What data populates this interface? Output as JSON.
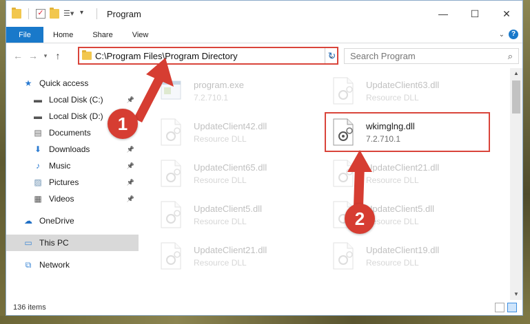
{
  "window": {
    "title": "Program",
    "controls": {
      "minimize": "—",
      "maximize": "☐",
      "close": "✕"
    }
  },
  "ribbon": {
    "tabs": [
      "File",
      "Home",
      "Share",
      "View"
    ],
    "help": "?"
  },
  "address": {
    "path": "C:\\Program Files\\Program Directory",
    "search_placeholder": "Search Program"
  },
  "nav": {
    "quick_access": "Quick access",
    "items": [
      {
        "label": "Local Disk (C:)",
        "icon": "drive-icon",
        "pinned": true
      },
      {
        "label": "Local Disk (D:)",
        "icon": "drive-icon",
        "pinned": false
      },
      {
        "label": "Documents",
        "icon": "documents-icon",
        "pinned": true
      },
      {
        "label": "Downloads",
        "icon": "download-icon",
        "pinned": true
      },
      {
        "label": "Music",
        "icon": "music-icon",
        "pinned": true
      },
      {
        "label": "Pictures",
        "icon": "pictures-icon",
        "pinned": true
      },
      {
        "label": "Videos",
        "icon": "videos-icon",
        "pinned": true
      }
    ],
    "onedrive": "OneDrive",
    "this_pc": "This PC",
    "network": "Network"
  },
  "files": [
    {
      "name": "program.exe",
      "desc": "7.2.710.1",
      "icon": "exe-icon",
      "faded": true
    },
    {
      "name": "UpdateClient63.dll",
      "desc": "Resource DLL",
      "icon": "dll-icon",
      "faded": true
    },
    {
      "name": "UpdateClient42.dll",
      "desc": "Resource DLL",
      "icon": "dll-icon",
      "faded": true
    },
    {
      "name": "wkimglng.dll",
      "desc": "7.2.710.1",
      "icon": "dll-gear-icon",
      "faded": false
    },
    {
      "name": "UpdateClient65.dll",
      "desc": "Resource DLL",
      "icon": "dll-icon",
      "faded": true
    },
    {
      "name": "UpdateClient21.dll",
      "desc": "Resource DLL",
      "icon": "dll-icon",
      "faded": true
    },
    {
      "name": "UpdateClient5.dll",
      "desc": "Resource DLL",
      "icon": "dll-icon",
      "faded": true
    },
    {
      "name": "UpdateClient5.dll",
      "desc": "Resource DLL",
      "icon": "dll-icon",
      "faded": true
    },
    {
      "name": "UpdateClient21.dll",
      "desc": "Resource DLL",
      "icon": "dll-icon",
      "faded": true
    },
    {
      "name": "UpdateClient19.dll",
      "desc": "Resource DLL",
      "icon": "dll-icon",
      "faded": true
    }
  ],
  "status": {
    "count": "136 items"
  },
  "annotations": {
    "step1": "1",
    "step2": "2",
    "color": "#d63d32"
  }
}
